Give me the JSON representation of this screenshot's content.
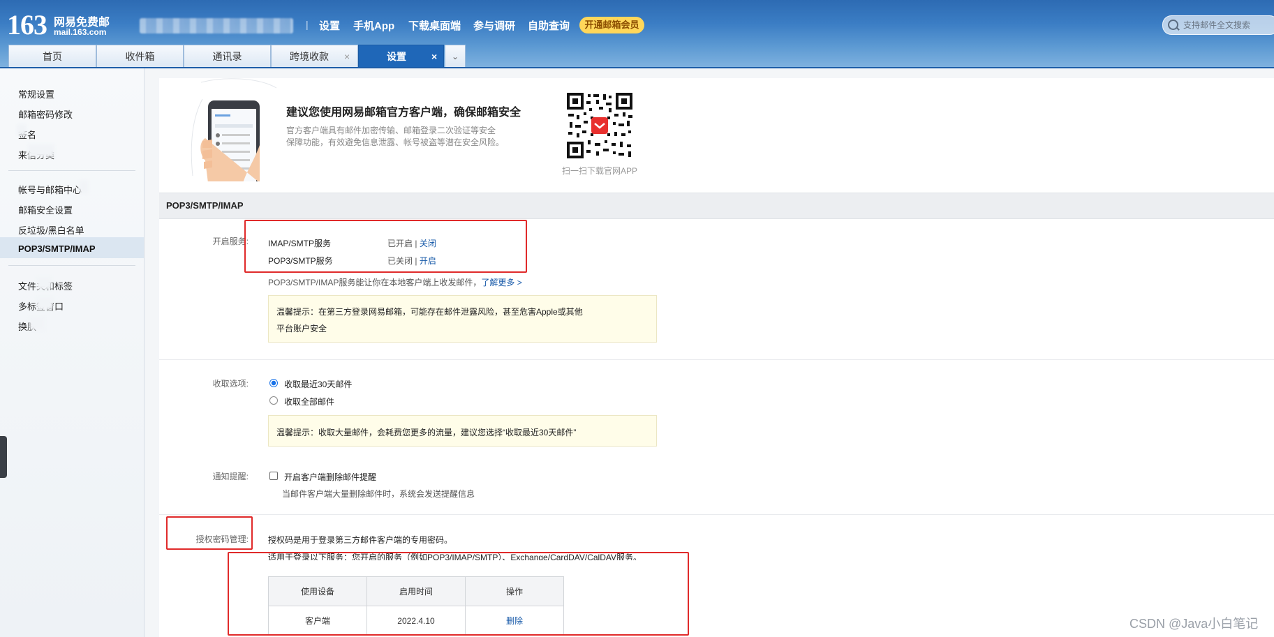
{
  "header": {
    "logo_number": "163",
    "logo_cn": "网易免费邮",
    "logo_domain": "mail.163.com",
    "separator": "|",
    "top_links": [
      "设置",
      "手机App",
      "下载桌面端",
      "参与调研",
      "自助查询"
    ],
    "vip_label": "开通邮箱会员",
    "search_placeholder": "支持邮件全文搜索"
  },
  "tabs": [
    {
      "label": "首页"
    },
    {
      "label": "收件箱"
    },
    {
      "label": "通讯录"
    },
    {
      "label": "跨境收款",
      "close": "×"
    },
    {
      "label": "设置",
      "close": "×",
      "active": true
    }
  ],
  "tab_menu_glyph": "⌄",
  "sidebar": {
    "group1": [
      "常规设置",
      "邮箱密码修改",
      "签名",
      "来信分类"
    ],
    "group2": [
      "帐号与邮箱中心",
      "邮箱安全设置",
      "反垃圾/黑白名单",
      "POP3/SMTP/IMAP"
    ],
    "group3": [
      "文件夹和标签",
      "多标签窗口",
      "换肤"
    ],
    "active": "POP3/SMTP/IMAP"
  },
  "promo": {
    "title": "建议您使用网易邮箱官方客户端，确保邮箱安全",
    "desc_line1": "官方客户端具有邮件加密传输、邮箱登录二次验证等安全",
    "desc_line2": "保障功能，有效避免信息泄露、帐号被盗等潜在安全风险。",
    "qr_caption": "扫一扫下载官网APP"
  },
  "section_title": "POP3/SMTP/IMAP",
  "services": {
    "label": "开启服务:",
    "items": [
      {
        "name": "IMAP/SMTP服务",
        "status": "已开启",
        "sep": "|",
        "action": "关闭"
      },
      {
        "name": "POP3/SMTP服务",
        "status": "已关闭",
        "sep": "|",
        "action": "开启"
      }
    ],
    "info": "POP3/SMTP/IMAP服务能让你在本地客户端上收发邮件，",
    "learn_more": "了解更多 >",
    "warn_line1": "温馨提示：在第三方登录网易邮箱，可能存在邮件泄露风险，甚至危害Apple或其他",
    "warn_line2": "平台账户安全"
  },
  "receive": {
    "label": "收取选项:",
    "options": [
      "收取最近30天邮件",
      "收取全部邮件"
    ],
    "selected_index": 0,
    "warn": "温馨提示：收取大量邮件，会耗费您更多的流量，建议您选择“收取最近30天邮件”"
  },
  "notify": {
    "label": "通知提醒:",
    "checkbox_label": "开启客户端删除邮件提醒",
    "checked": false,
    "sub": "当邮件客户端大量删除邮件时，系统会发送提醒信息"
  },
  "auth": {
    "label": "授权密码管理:",
    "desc": "授权码是用于登录第三方邮件客户端的专用密码。",
    "desc2": "适用于登录以下服务：您开启的服务（例如POP3/IMAP/SMTP）、Exchange/CardDAV/CalDAV服务。",
    "table_headers": [
      "使用设备",
      "启用时间",
      "操作"
    ],
    "rows": [
      {
        "device": "客户端",
        "time": "2022.4.10",
        "action": "删除"
      }
    ]
  },
  "watermark": "CSDN @Java小白笔记",
  "colors": {
    "header_blue": "#2d6bb3",
    "active_tab": "#1f67b8",
    "link": "#1558a8",
    "annotation_red": "#e02a2a",
    "vip_yellow": "#ffd75a"
  }
}
